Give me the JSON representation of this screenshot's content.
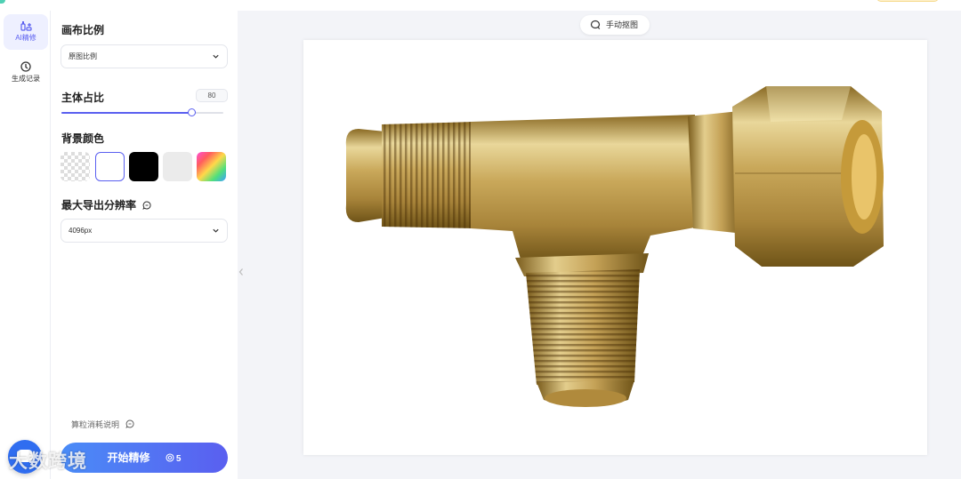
{
  "nav": {
    "items": [
      {
        "label": "AI精修",
        "icon": "ai-refine-icon",
        "active": true
      },
      {
        "label": "生成记录",
        "icon": "history-clock-icon",
        "active": false
      }
    ]
  },
  "panel": {
    "canvas_ratio": {
      "title": "画布比例",
      "selected": "原图比例"
    },
    "subject_ratio": {
      "title": "主体占比",
      "value": "80",
      "level_percent": 80
    },
    "background_color": {
      "title": "背景颜色",
      "options": [
        "transparent",
        "#FFFFFF",
        "#000000",
        "#EBEBEB",
        "rainbow-custom"
      ],
      "selected": "#FFFFFF"
    },
    "max_resolution": {
      "title": "最大导出分辨率",
      "selected": "4096px"
    },
    "cost_note": "算粒消耗说明",
    "start_button": {
      "label": "开始精修",
      "cost": "5"
    }
  },
  "toolbar": {
    "manual_cutout": "手动抠图"
  },
  "watermark": "大数跨境",
  "colors": {
    "accent": "#5A5FF0",
    "button_gradient_start": "#4A8CF7",
    "canvas_bg": "#F3F4F8"
  }
}
